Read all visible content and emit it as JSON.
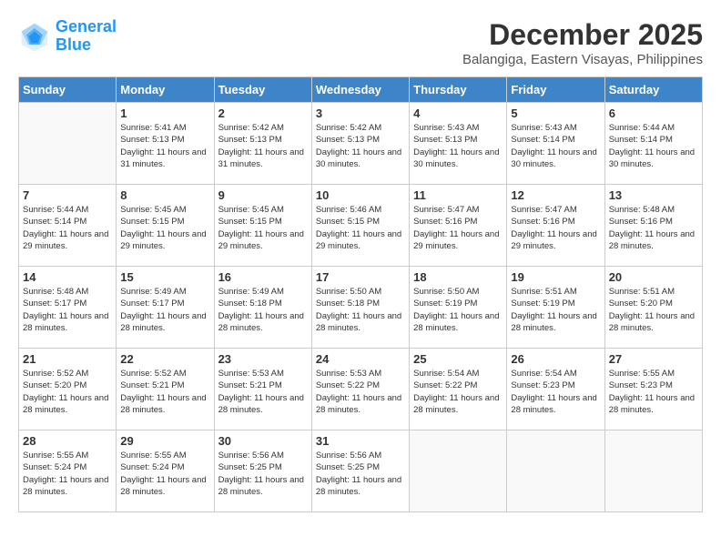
{
  "logo": {
    "line1": "General",
    "line2": "Blue"
  },
  "title": "December 2025",
  "subtitle": "Balangiga, Eastern Visayas, Philippines",
  "days_of_week": [
    "Sunday",
    "Monday",
    "Tuesday",
    "Wednesday",
    "Thursday",
    "Friday",
    "Saturday"
  ],
  "weeks": [
    [
      {
        "num": "",
        "sunrise": "",
        "sunset": "",
        "daylight": ""
      },
      {
        "num": "1",
        "sunrise": "Sunrise: 5:41 AM",
        "sunset": "Sunset: 5:13 PM",
        "daylight": "Daylight: 11 hours and 31 minutes."
      },
      {
        "num": "2",
        "sunrise": "Sunrise: 5:42 AM",
        "sunset": "Sunset: 5:13 PM",
        "daylight": "Daylight: 11 hours and 31 minutes."
      },
      {
        "num": "3",
        "sunrise": "Sunrise: 5:42 AM",
        "sunset": "Sunset: 5:13 PM",
        "daylight": "Daylight: 11 hours and 30 minutes."
      },
      {
        "num": "4",
        "sunrise": "Sunrise: 5:43 AM",
        "sunset": "Sunset: 5:13 PM",
        "daylight": "Daylight: 11 hours and 30 minutes."
      },
      {
        "num": "5",
        "sunrise": "Sunrise: 5:43 AM",
        "sunset": "Sunset: 5:14 PM",
        "daylight": "Daylight: 11 hours and 30 minutes."
      },
      {
        "num": "6",
        "sunrise": "Sunrise: 5:44 AM",
        "sunset": "Sunset: 5:14 PM",
        "daylight": "Daylight: 11 hours and 30 minutes."
      }
    ],
    [
      {
        "num": "7",
        "sunrise": "Sunrise: 5:44 AM",
        "sunset": "Sunset: 5:14 PM",
        "daylight": "Daylight: 11 hours and 29 minutes."
      },
      {
        "num": "8",
        "sunrise": "Sunrise: 5:45 AM",
        "sunset": "Sunset: 5:15 PM",
        "daylight": "Daylight: 11 hours and 29 minutes."
      },
      {
        "num": "9",
        "sunrise": "Sunrise: 5:45 AM",
        "sunset": "Sunset: 5:15 PM",
        "daylight": "Daylight: 11 hours and 29 minutes."
      },
      {
        "num": "10",
        "sunrise": "Sunrise: 5:46 AM",
        "sunset": "Sunset: 5:15 PM",
        "daylight": "Daylight: 11 hours and 29 minutes."
      },
      {
        "num": "11",
        "sunrise": "Sunrise: 5:47 AM",
        "sunset": "Sunset: 5:16 PM",
        "daylight": "Daylight: 11 hours and 29 minutes."
      },
      {
        "num": "12",
        "sunrise": "Sunrise: 5:47 AM",
        "sunset": "Sunset: 5:16 PM",
        "daylight": "Daylight: 11 hours and 29 minutes."
      },
      {
        "num": "13",
        "sunrise": "Sunrise: 5:48 AM",
        "sunset": "Sunset: 5:16 PM",
        "daylight": "Daylight: 11 hours and 28 minutes."
      }
    ],
    [
      {
        "num": "14",
        "sunrise": "Sunrise: 5:48 AM",
        "sunset": "Sunset: 5:17 PM",
        "daylight": "Daylight: 11 hours and 28 minutes."
      },
      {
        "num": "15",
        "sunrise": "Sunrise: 5:49 AM",
        "sunset": "Sunset: 5:17 PM",
        "daylight": "Daylight: 11 hours and 28 minutes."
      },
      {
        "num": "16",
        "sunrise": "Sunrise: 5:49 AM",
        "sunset": "Sunset: 5:18 PM",
        "daylight": "Daylight: 11 hours and 28 minutes."
      },
      {
        "num": "17",
        "sunrise": "Sunrise: 5:50 AM",
        "sunset": "Sunset: 5:18 PM",
        "daylight": "Daylight: 11 hours and 28 minutes."
      },
      {
        "num": "18",
        "sunrise": "Sunrise: 5:50 AM",
        "sunset": "Sunset: 5:19 PM",
        "daylight": "Daylight: 11 hours and 28 minutes."
      },
      {
        "num": "19",
        "sunrise": "Sunrise: 5:51 AM",
        "sunset": "Sunset: 5:19 PM",
        "daylight": "Daylight: 11 hours and 28 minutes."
      },
      {
        "num": "20",
        "sunrise": "Sunrise: 5:51 AM",
        "sunset": "Sunset: 5:20 PM",
        "daylight": "Daylight: 11 hours and 28 minutes."
      }
    ],
    [
      {
        "num": "21",
        "sunrise": "Sunrise: 5:52 AM",
        "sunset": "Sunset: 5:20 PM",
        "daylight": "Daylight: 11 hours and 28 minutes."
      },
      {
        "num": "22",
        "sunrise": "Sunrise: 5:52 AM",
        "sunset": "Sunset: 5:21 PM",
        "daylight": "Daylight: 11 hours and 28 minutes."
      },
      {
        "num": "23",
        "sunrise": "Sunrise: 5:53 AM",
        "sunset": "Sunset: 5:21 PM",
        "daylight": "Daylight: 11 hours and 28 minutes."
      },
      {
        "num": "24",
        "sunrise": "Sunrise: 5:53 AM",
        "sunset": "Sunset: 5:22 PM",
        "daylight": "Daylight: 11 hours and 28 minutes."
      },
      {
        "num": "25",
        "sunrise": "Sunrise: 5:54 AM",
        "sunset": "Sunset: 5:22 PM",
        "daylight": "Daylight: 11 hours and 28 minutes."
      },
      {
        "num": "26",
        "sunrise": "Sunrise: 5:54 AM",
        "sunset": "Sunset: 5:23 PM",
        "daylight": "Daylight: 11 hours and 28 minutes."
      },
      {
        "num": "27",
        "sunrise": "Sunrise: 5:55 AM",
        "sunset": "Sunset: 5:23 PM",
        "daylight": "Daylight: 11 hours and 28 minutes."
      }
    ],
    [
      {
        "num": "28",
        "sunrise": "Sunrise: 5:55 AM",
        "sunset": "Sunset: 5:24 PM",
        "daylight": "Daylight: 11 hours and 28 minutes."
      },
      {
        "num": "29",
        "sunrise": "Sunrise: 5:55 AM",
        "sunset": "Sunset: 5:24 PM",
        "daylight": "Daylight: 11 hours and 28 minutes."
      },
      {
        "num": "30",
        "sunrise": "Sunrise: 5:56 AM",
        "sunset": "Sunset: 5:25 PM",
        "daylight": "Daylight: 11 hours and 28 minutes."
      },
      {
        "num": "31",
        "sunrise": "Sunrise: 5:56 AM",
        "sunset": "Sunset: 5:25 PM",
        "daylight": "Daylight: 11 hours and 28 minutes."
      },
      {
        "num": "",
        "sunrise": "",
        "sunset": "",
        "daylight": ""
      },
      {
        "num": "",
        "sunrise": "",
        "sunset": "",
        "daylight": ""
      },
      {
        "num": "",
        "sunrise": "",
        "sunset": "",
        "daylight": ""
      }
    ]
  ]
}
